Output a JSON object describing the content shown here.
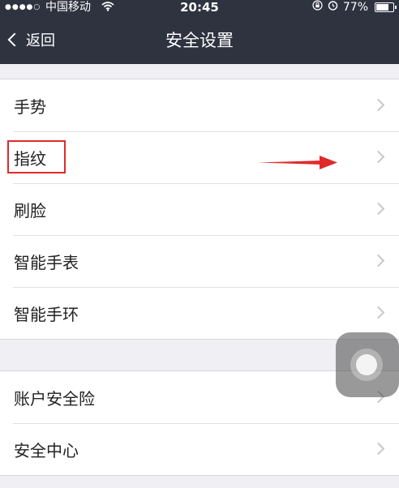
{
  "status_bar": {
    "signal_dots": "●●●●○",
    "carrier": "中国移动",
    "time": "20:45",
    "battery_percent": "77%",
    "battery_level": 0.77
  },
  "nav": {
    "back_label": "返回",
    "title": "安全设置"
  },
  "groups": [
    {
      "items": [
        {
          "label": "手势"
        },
        {
          "label": "指纹"
        },
        {
          "label": "刷脸"
        },
        {
          "label": "智能手表"
        },
        {
          "label": "智能手环"
        }
      ]
    },
    {
      "items": [
        {
          "label": "账户安全险"
        },
        {
          "label": "安全中心"
        }
      ]
    }
  ],
  "annotation": {
    "color": "#e02a2a"
  },
  "colors": {
    "header_bg": "#2f3340",
    "page_bg": "#efeff4",
    "chevron": "#c7c7cc"
  }
}
